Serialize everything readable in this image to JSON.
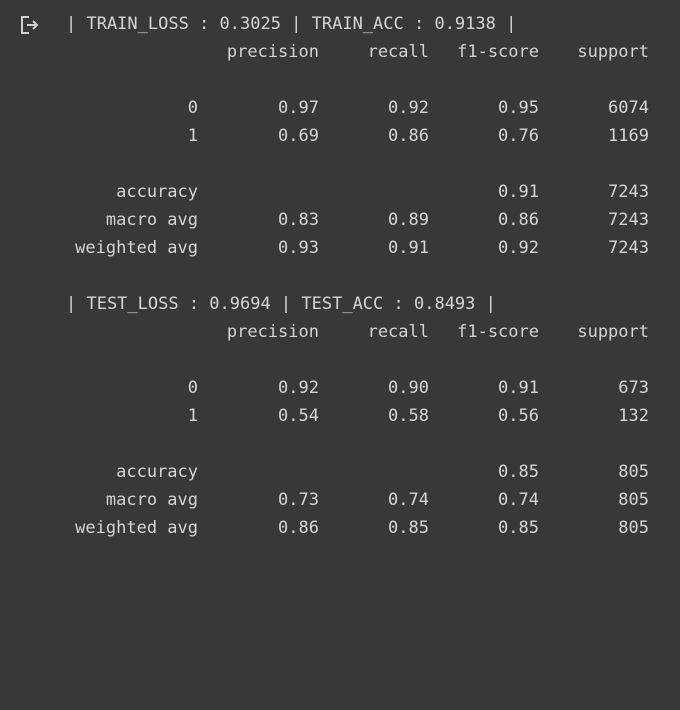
{
  "output_icon": "output-arrow-icon",
  "sections": [
    {
      "header": "| TRAIN_LOSS : 0.3025 | TRAIN_ACC : 0.9138 |",
      "columns": [
        "precision",
        "recall",
        "f1-score",
        "support"
      ],
      "rows": [
        {
          "label": "0",
          "precision": "0.97",
          "recall": "0.92",
          "f1": "0.95",
          "support": "6074"
        },
        {
          "label": "1",
          "precision": "0.69",
          "recall": "0.86",
          "f1": "0.76",
          "support": "1169"
        }
      ],
      "summary": [
        {
          "label": "accuracy",
          "precision": "",
          "recall": "",
          "f1": "0.91",
          "support": "7243"
        },
        {
          "label": "macro avg",
          "precision": "0.83",
          "recall": "0.89",
          "f1": "0.86",
          "support": "7243"
        },
        {
          "label": "weighted avg",
          "precision": "0.93",
          "recall": "0.91",
          "f1": "0.92",
          "support": "7243"
        }
      ]
    },
    {
      "header": "| TEST_LOSS : 0.9694 | TEST_ACC : 0.8493 |",
      "columns": [
        "precision",
        "recall",
        "f1-score",
        "support"
      ],
      "rows": [
        {
          "label": "0",
          "precision": "0.92",
          "recall": "0.90",
          "f1": "0.91",
          "support": "673"
        },
        {
          "label": "1",
          "precision": "0.54",
          "recall": "0.58",
          "f1": "0.56",
          "support": "132"
        }
      ],
      "summary": [
        {
          "label": "accuracy",
          "precision": "",
          "recall": "",
          "f1": "0.85",
          "support": "805"
        },
        {
          "label": "macro avg",
          "precision": "0.73",
          "recall": "0.74",
          "f1": "0.74",
          "support": "805"
        },
        {
          "label": "weighted avg",
          "precision": "0.86",
          "recall": "0.85",
          "f1": "0.85",
          "support": "805"
        }
      ]
    }
  ]
}
